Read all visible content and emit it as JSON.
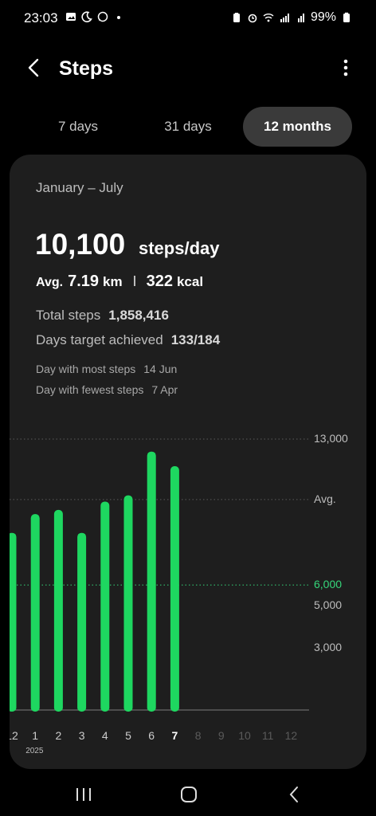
{
  "status_bar": {
    "time": "23:03",
    "battery": "99%",
    "left_icons": [
      "gallery-icon",
      "moon-icon",
      "whatsapp-icon",
      "dot-icon"
    ],
    "right_icons": [
      "battery-saver-icon",
      "alarm-icon",
      "wifi-icon",
      "signal-icon",
      "signal-r-icon",
      "battery-icon"
    ]
  },
  "header": {
    "title": "Steps"
  },
  "tabs": [
    {
      "label": "7 days",
      "active": false
    },
    {
      "label": "31 days",
      "active": false
    },
    {
      "label": "12 months",
      "active": true
    }
  ],
  "summary": {
    "period": "January – July",
    "daily_avg": "10,100",
    "daily_unit": "steps/day",
    "avg_label": "Avg.",
    "distance": "7.19",
    "distance_unit": "km",
    "calories": "322",
    "calories_unit": "kcal",
    "total_label": "Total steps",
    "total_value": "1,858,416",
    "target_label": "Days target achieved",
    "target_value": "133/184",
    "most_label": "Day with most steps",
    "most_value": "14 Jun",
    "fewest_label": "Day with fewest steps",
    "fewest_value": "7 Apr"
  },
  "chart_data": {
    "type": "bar",
    "categories": [
      "12",
      "1",
      "2",
      "3",
      "4",
      "5",
      "6",
      "7",
      "8",
      "9",
      "10",
      "11",
      "12"
    ],
    "values": [
      8500,
      9400,
      9600,
      8500,
      10000,
      10300,
      12400,
      11700,
      null,
      null,
      null,
      null,
      null
    ],
    "year_label": "2025",
    "ylim": [
      0,
      13000
    ],
    "y_ticks": [
      {
        "label": "13,000",
        "value": 13000,
        "kind": "normal"
      },
      {
        "label": "Avg.",
        "value": 10100,
        "kind": "avg"
      },
      {
        "label": "6,000",
        "value": 6000,
        "kind": "target"
      },
      {
        "label": "5,000",
        "value": 5000,
        "kind": "normal"
      },
      {
        "label": "3,000",
        "value": 3000,
        "kind": "normal"
      }
    ],
    "current_category_index": 7,
    "colors": {
      "bar": "#1ed760",
      "target": "#36d67a",
      "grid": "#5a5a5a"
    }
  },
  "nav": {
    "buttons": [
      "recent-apps-icon",
      "home-icon",
      "back-nav-icon"
    ]
  }
}
